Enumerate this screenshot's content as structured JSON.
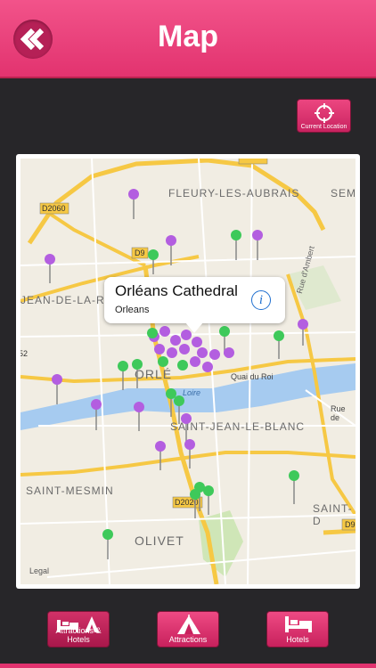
{
  "header": {
    "title": "Map",
    "back_icon": "double-chevron-left-icon"
  },
  "current_location": {
    "label": "Current Location",
    "icon": "crosshair-icon"
  },
  "map": {
    "place_labels": [
      "FLEURY-LES-AUBRAIS",
      "SEM",
      "D2060",
      "D9",
      "JEAN-DE-LA-RU",
      "Rue d'Ambert",
      "Quai du Roi",
      "ORLÉ",
      "Loire",
      "SAINT-JEAN-LE-BLANC",
      "Rue de",
      "SAINT-MESMIN",
      "D2020",
      "SAINT-D",
      "OLIVET",
      "D9",
      "Legal",
      "52"
    ],
    "callout": {
      "title": "Orléans Cathedral",
      "subtitle": "Orleans",
      "info_icon": "info-icon"
    }
  },
  "tabs": [
    {
      "label": "Attractions & Hotels",
      "icon": "bed-tent-icon"
    },
    {
      "label": "Attractions",
      "icon": "tent-icon"
    },
    {
      "label": "Hotels",
      "icon": "bed-icon"
    }
  ],
  "colors": {
    "accent": "#e2336f",
    "pin_purple": "#b35ee0",
    "pin_green": "#3ec95a",
    "background": "#272629"
  }
}
